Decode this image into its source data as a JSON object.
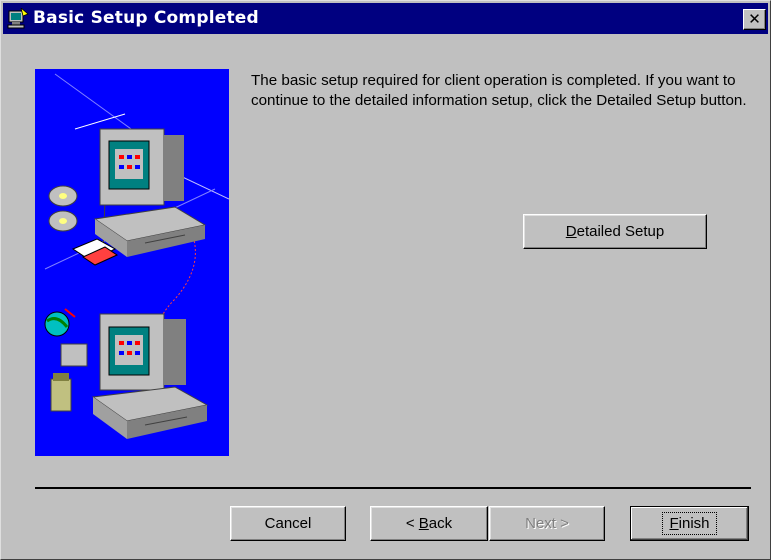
{
  "window": {
    "title": "Basic Setup Completed",
    "close_label": "✕"
  },
  "message": "The basic setup required for client operation is completed.  If you want to continue to the detailed information setup, click the Detailed Setup button.",
  "buttons": {
    "detailed_setup": {
      "pre": "",
      "accel": "D",
      "post": "etailed Setup"
    },
    "cancel": {
      "label": "Cancel"
    },
    "back": {
      "pre": "< ",
      "accel": "B",
      "post": "ack"
    },
    "next": {
      "label": "Next >"
    },
    "finish": {
      "pre": "",
      "accel": "F",
      "post": "inish"
    }
  },
  "colors": {
    "titlebar": "#000080",
    "dialog_face": "#c0c0c0",
    "illustration_bg": "#0000ff"
  },
  "icons": {
    "title_icon": "setup-computer-icon",
    "illustration": "networked-computers-illustration"
  }
}
